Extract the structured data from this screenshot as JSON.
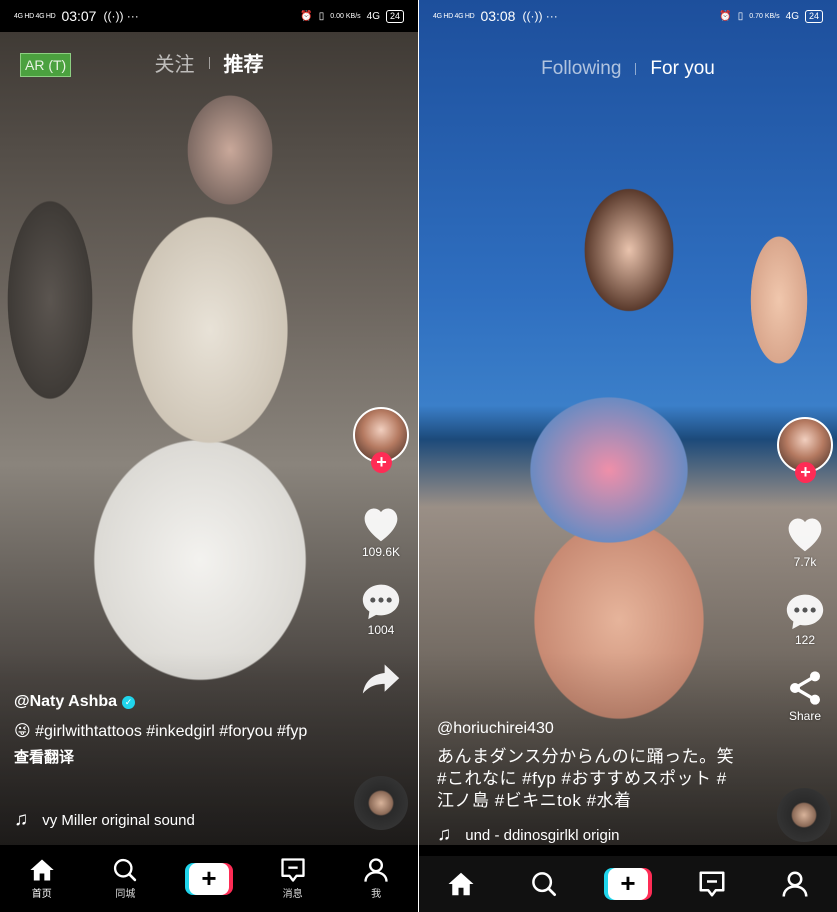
{
  "screens": [
    {
      "status": {
        "signal": "4G HD 4G HD",
        "time": "03:07",
        "extra": "((·)) ···",
        "net_speed": "0.00 KB/s",
        "network": "4G",
        "battery": "24"
      },
      "ar_badge": "AR (T)",
      "tabs": [
        {
          "label": "关注",
          "active": false
        },
        {
          "label": "推荐",
          "active": true
        }
      ],
      "actions": {
        "like_count": "109.6K",
        "comment_count": "1004",
        "share_label": ""
      },
      "caption": {
        "username": "@Naty Ashba",
        "verified": true,
        "description": "😜 #girlwithtattoos #inkedgirl #foryou #fyp",
        "translate": "查看翻译"
      },
      "music": {
        "note": "♫",
        "text": "vy Miller    original sound"
      },
      "nav": [
        {
          "label": "首页",
          "icon": "home-icon",
          "active": true
        },
        {
          "label": "同城",
          "icon": "search-icon",
          "active": false
        },
        {
          "label": "",
          "icon": "plus-icon",
          "active": false
        },
        {
          "label": "消息",
          "icon": "inbox-icon",
          "active": false
        },
        {
          "label": "我",
          "icon": "profile-icon",
          "active": false
        }
      ]
    },
    {
      "status": {
        "signal": "4G HD 4G HD",
        "time": "03:08",
        "extra": "((·)) ···",
        "net_speed": "0.70 KB/s",
        "network": "4G",
        "battery": "24"
      },
      "tabs": [
        {
          "label": "Following",
          "active": false
        },
        {
          "label": "For you",
          "active": true
        }
      ],
      "actions": {
        "like_count": "7.7k",
        "comment_count": "122",
        "share_label": "Share"
      },
      "caption": {
        "username": "@horiuchirei430",
        "verified": false,
        "description": "あんまダンス分からんのに踊った。笑 #これなに #fyp #おすすめスポット #江ノ島 #ビキニtok #水着",
        "translate": ""
      },
      "music": {
        "note": "♫",
        "text": "und - ddinosgirlkl    origin"
      },
      "nav": [
        {
          "label": "",
          "icon": "home-icon",
          "active": true
        },
        {
          "label": "",
          "icon": "search-icon",
          "active": false
        },
        {
          "label": "",
          "icon": "plus-icon",
          "active": false
        },
        {
          "label": "",
          "icon": "inbox-icon",
          "active": false
        },
        {
          "label": "",
          "icon": "profile-icon",
          "active": false
        }
      ]
    }
  ]
}
